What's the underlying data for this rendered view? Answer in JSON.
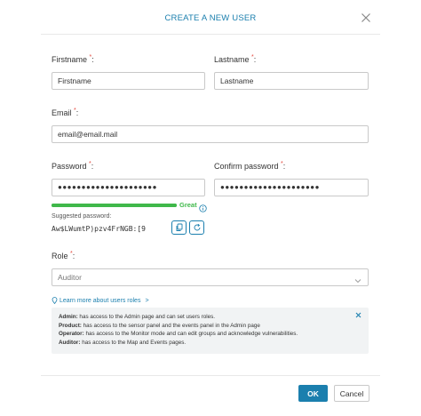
{
  "dialog": {
    "title": "CREATE A NEW USER"
  },
  "form": {
    "firstname": {
      "label": "Firstname",
      "required_mark": "*",
      "colon": ":",
      "value": "",
      "placeholder": "Firstname"
    },
    "lastname": {
      "label": "Lastname",
      "required_mark": "*",
      "colon": ":",
      "value": "",
      "placeholder": "Lastname"
    },
    "email": {
      "label": "Email",
      "required_mark": "*",
      "colon": ":",
      "value": "",
      "placeholder": "email@email.mail"
    },
    "password": {
      "label": "Password",
      "required_mark": "*",
      "colon": ":",
      "value": "●●●●●●●●●●●●●●●●●●●●●"
    },
    "confirm_password": {
      "label": "Confirm password",
      "required_mark": "*",
      "colon": ":",
      "value": "●●●●●●●●●●●●●●●●●●●●●"
    },
    "strength": {
      "label": "Great",
      "level": 1.0,
      "color": "#3fb84a"
    },
    "suggested": {
      "label": "Suggested password:",
      "value": "Aw$LWumtP)pzv4FrNGB:[9"
    },
    "role": {
      "label": "Role",
      "required_mark": "*",
      "colon": ":",
      "selected": "Auditor"
    }
  },
  "roles_help": {
    "link_text": "Learn more about users roles",
    "chevron": ">",
    "entries": [
      {
        "name": "Admin:",
        "desc": " has access to the Admin page and can set users roles."
      },
      {
        "name": "Product:",
        "desc": " has access to the sensor panel and the events panel in the Admin page"
      },
      {
        "name": "Operator:",
        "desc": " has access to the Monitor mode and can edit groups and acknowledge vulnerabilities."
      },
      {
        "name": "Auditor:",
        "desc": " has access to the Map and Events pages."
      }
    ]
  },
  "actions": {
    "ok_label": "OK",
    "cancel_label": "Cancel"
  },
  "colors": {
    "accent": "#1b7fae",
    "required": "#e4493e",
    "success": "#3fb84a",
    "info_bg": "#f1f3f4"
  },
  "icons": {
    "close": "close-icon",
    "info": "info-circle-icon",
    "copy": "copy-icon",
    "refresh": "refresh-icon",
    "dropdown": "chevron-down-icon",
    "location": "map-pin-icon"
  }
}
